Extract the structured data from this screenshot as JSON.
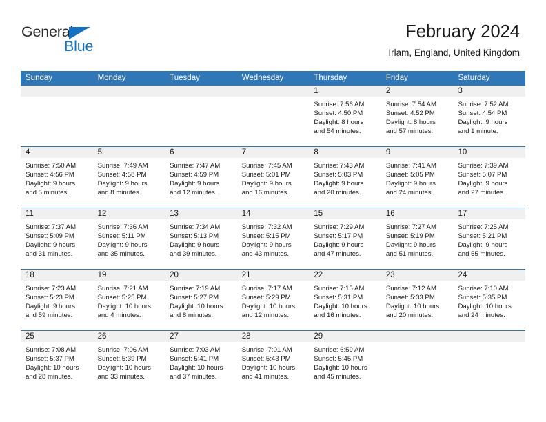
{
  "brand": {
    "name_part1": "General",
    "name_part2": "Blue"
  },
  "header": {
    "title": "February 2024",
    "location": "Irlam, England, United Kingdom"
  },
  "calendar": {
    "weekdays": [
      "Sunday",
      "Monday",
      "Tuesday",
      "Wednesday",
      "Thursday",
      "Friday",
      "Saturday"
    ],
    "accent_color": "#3077b8",
    "daynum_band_color": "#f0f0f0",
    "weeks": [
      {
        "days": [
          {
            "date": "",
            "lines": []
          },
          {
            "date": "",
            "lines": []
          },
          {
            "date": "",
            "lines": []
          },
          {
            "date": "",
            "lines": []
          },
          {
            "date": "1",
            "lines": [
              "Sunrise: 7:56 AM",
              "Sunset: 4:50 PM",
              "Daylight: 8 hours",
              "and 54 minutes."
            ]
          },
          {
            "date": "2",
            "lines": [
              "Sunrise: 7:54 AM",
              "Sunset: 4:52 PM",
              "Daylight: 8 hours",
              "and 57 minutes."
            ]
          },
          {
            "date": "3",
            "lines": [
              "Sunrise: 7:52 AM",
              "Sunset: 4:54 PM",
              "Daylight: 9 hours",
              "and 1 minute."
            ]
          }
        ]
      },
      {
        "days": [
          {
            "date": "4",
            "lines": [
              "Sunrise: 7:50 AM",
              "Sunset: 4:56 PM",
              "Daylight: 9 hours",
              "and 5 minutes."
            ]
          },
          {
            "date": "5",
            "lines": [
              "Sunrise: 7:49 AM",
              "Sunset: 4:58 PM",
              "Daylight: 9 hours",
              "and 8 minutes."
            ]
          },
          {
            "date": "6",
            "lines": [
              "Sunrise: 7:47 AM",
              "Sunset: 4:59 PM",
              "Daylight: 9 hours",
              "and 12 minutes."
            ]
          },
          {
            "date": "7",
            "lines": [
              "Sunrise: 7:45 AM",
              "Sunset: 5:01 PM",
              "Daylight: 9 hours",
              "and 16 minutes."
            ]
          },
          {
            "date": "8",
            "lines": [
              "Sunrise: 7:43 AM",
              "Sunset: 5:03 PM",
              "Daylight: 9 hours",
              "and 20 minutes."
            ]
          },
          {
            "date": "9",
            "lines": [
              "Sunrise: 7:41 AM",
              "Sunset: 5:05 PM",
              "Daylight: 9 hours",
              "and 24 minutes."
            ]
          },
          {
            "date": "10",
            "lines": [
              "Sunrise: 7:39 AM",
              "Sunset: 5:07 PM",
              "Daylight: 9 hours",
              "and 27 minutes."
            ]
          }
        ]
      },
      {
        "days": [
          {
            "date": "11",
            "lines": [
              "Sunrise: 7:37 AM",
              "Sunset: 5:09 PM",
              "Daylight: 9 hours",
              "and 31 minutes."
            ]
          },
          {
            "date": "12",
            "lines": [
              "Sunrise: 7:36 AM",
              "Sunset: 5:11 PM",
              "Daylight: 9 hours",
              "and 35 minutes."
            ]
          },
          {
            "date": "13",
            "lines": [
              "Sunrise: 7:34 AM",
              "Sunset: 5:13 PM",
              "Daylight: 9 hours",
              "and 39 minutes."
            ]
          },
          {
            "date": "14",
            "lines": [
              "Sunrise: 7:32 AM",
              "Sunset: 5:15 PM",
              "Daylight: 9 hours",
              "and 43 minutes."
            ]
          },
          {
            "date": "15",
            "lines": [
              "Sunrise: 7:29 AM",
              "Sunset: 5:17 PM",
              "Daylight: 9 hours",
              "and 47 minutes."
            ]
          },
          {
            "date": "16",
            "lines": [
              "Sunrise: 7:27 AM",
              "Sunset: 5:19 PM",
              "Daylight: 9 hours",
              "and 51 minutes."
            ]
          },
          {
            "date": "17",
            "lines": [
              "Sunrise: 7:25 AM",
              "Sunset: 5:21 PM",
              "Daylight: 9 hours",
              "and 55 minutes."
            ]
          }
        ]
      },
      {
        "days": [
          {
            "date": "18",
            "lines": [
              "Sunrise: 7:23 AM",
              "Sunset: 5:23 PM",
              "Daylight: 9 hours",
              "and 59 minutes."
            ]
          },
          {
            "date": "19",
            "lines": [
              "Sunrise: 7:21 AM",
              "Sunset: 5:25 PM",
              "Daylight: 10 hours",
              "and 4 minutes."
            ]
          },
          {
            "date": "20",
            "lines": [
              "Sunrise: 7:19 AM",
              "Sunset: 5:27 PM",
              "Daylight: 10 hours",
              "and 8 minutes."
            ]
          },
          {
            "date": "21",
            "lines": [
              "Sunrise: 7:17 AM",
              "Sunset: 5:29 PM",
              "Daylight: 10 hours",
              "and 12 minutes."
            ]
          },
          {
            "date": "22",
            "lines": [
              "Sunrise: 7:15 AM",
              "Sunset: 5:31 PM",
              "Daylight: 10 hours",
              "and 16 minutes."
            ]
          },
          {
            "date": "23",
            "lines": [
              "Sunrise: 7:12 AM",
              "Sunset: 5:33 PM",
              "Daylight: 10 hours",
              "and 20 minutes."
            ]
          },
          {
            "date": "24",
            "lines": [
              "Sunrise: 7:10 AM",
              "Sunset: 5:35 PM",
              "Daylight: 10 hours",
              "and 24 minutes."
            ]
          }
        ]
      },
      {
        "days": [
          {
            "date": "25",
            "lines": [
              "Sunrise: 7:08 AM",
              "Sunset: 5:37 PM",
              "Daylight: 10 hours",
              "and 28 minutes."
            ]
          },
          {
            "date": "26",
            "lines": [
              "Sunrise: 7:06 AM",
              "Sunset: 5:39 PM",
              "Daylight: 10 hours",
              "and 33 minutes."
            ]
          },
          {
            "date": "27",
            "lines": [
              "Sunrise: 7:03 AM",
              "Sunset: 5:41 PM",
              "Daylight: 10 hours",
              "and 37 minutes."
            ]
          },
          {
            "date": "28",
            "lines": [
              "Sunrise: 7:01 AM",
              "Sunset: 5:43 PM",
              "Daylight: 10 hours",
              "and 41 minutes."
            ]
          },
          {
            "date": "29",
            "lines": [
              "Sunrise: 6:59 AM",
              "Sunset: 5:45 PM",
              "Daylight: 10 hours",
              "and 45 minutes."
            ]
          },
          {
            "date": "",
            "lines": []
          },
          {
            "date": "",
            "lines": []
          }
        ]
      }
    ]
  }
}
